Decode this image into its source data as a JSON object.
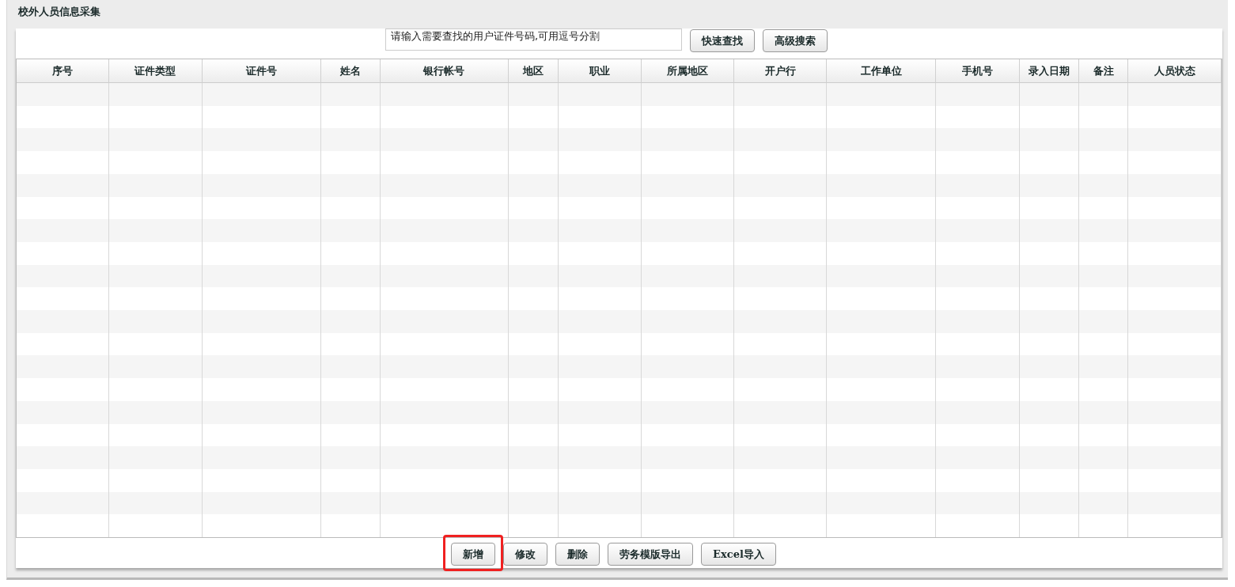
{
  "panel": {
    "title": "校外人员信息采集"
  },
  "search": {
    "value": "请输入需要查找的用户证件号码,可用逗号分割"
  },
  "search_buttons": [
    {
      "label": "快速查找"
    },
    {
      "label": "高级搜索"
    }
  ],
  "table": {
    "columns": [
      "序号",
      "证件类型",
      "证件号",
      "姓名",
      "银行帐号",
      "地区",
      "职业",
      "所属地区",
      "开户行",
      "工作单位",
      "手机号",
      "录入日期",
      "备注",
      "人员状态"
    ]
  },
  "actions": [
    {
      "label": "新增",
      "highlighted": true
    },
    {
      "label": "修改",
      "highlighted": false
    },
    {
      "label": "删除",
      "highlighted": false
    },
    {
      "label": "劳务模版导出",
      "highlighted": false
    },
    {
      "label": "Excel导入",
      "highlighted": false
    }
  ]
}
